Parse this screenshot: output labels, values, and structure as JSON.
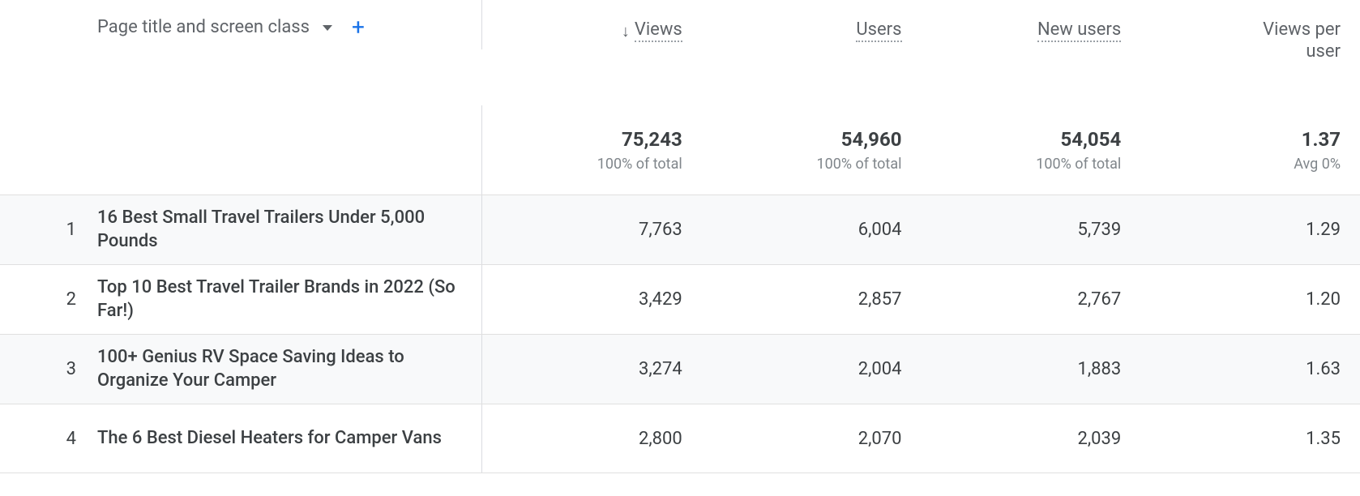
{
  "dimension": {
    "label": "Page title and screen class"
  },
  "columns": {
    "views": {
      "label": "Views",
      "sorted": true,
      "dotted": true
    },
    "users": {
      "label": "Users",
      "dotted": true
    },
    "new_users": {
      "label": "New users",
      "dotted": true
    },
    "views_per_user": {
      "label_line1": "Views per",
      "label_line2": "user",
      "dotted": false
    }
  },
  "summary": {
    "views": {
      "value": "75,243",
      "sub": "100% of total"
    },
    "users": {
      "value": "54,960",
      "sub": "100% of total"
    },
    "new_users": {
      "value": "54,054",
      "sub": "100% of total"
    },
    "views_per_user": {
      "value": "1.37",
      "sub": "Avg 0%"
    }
  },
  "rows": [
    {
      "index": "1",
      "title": "16 Best Small Travel Trailers Under 5,000 Pounds",
      "views": "7,763",
      "users": "6,004",
      "new_users": "5,739",
      "views_per_user": "1.29"
    },
    {
      "index": "2",
      "title": "Top 10 Best Travel Trailer Brands in 2022 (So Far!)",
      "views": "3,429",
      "users": "2,857",
      "new_users": "2,767",
      "views_per_user": "1.20"
    },
    {
      "index": "3",
      "title": "100+ Genius RV Space Saving Ideas to Organize Your Camper",
      "views": "3,274",
      "users": "2,004",
      "new_users": "1,883",
      "views_per_user": "1.63"
    },
    {
      "index": "4",
      "title": "The 6 Best Diesel Heaters for Camper Vans",
      "views": "2,800",
      "users": "2,070",
      "new_users": "2,039",
      "views_per_user": "1.35"
    }
  ]
}
